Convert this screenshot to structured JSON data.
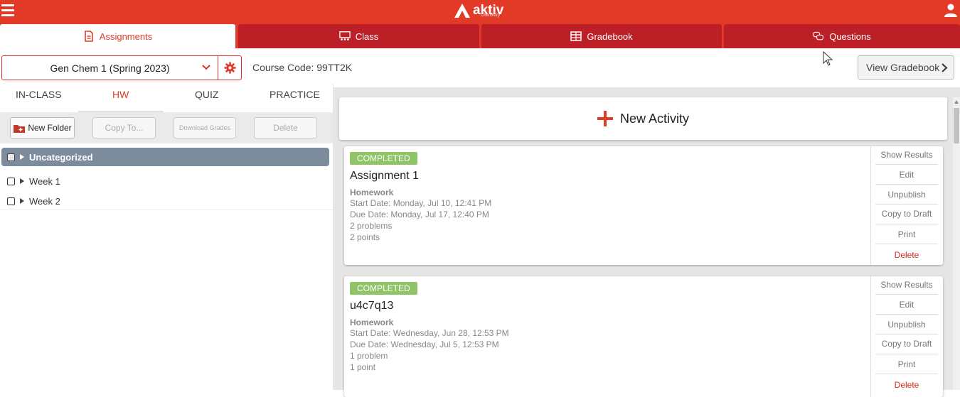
{
  "header": {
    "logo_text": "aktiv",
    "logo_sub": "Chemistry"
  },
  "tabs": [
    {
      "label": "Assignments",
      "icon": "assignment-icon",
      "active": true
    },
    {
      "label": "Class",
      "icon": "class-icon",
      "active": false
    },
    {
      "label": "Gradebook",
      "icon": "gradebook-icon",
      "active": false
    },
    {
      "label": "Questions",
      "icon": "questions-icon",
      "active": false
    }
  ],
  "course": {
    "selected": "Gen Chem 1 (Spring 2023)",
    "code_label": "Course Code: 99TT2K",
    "view_gradebook": "View Gradebook"
  },
  "subtabs": [
    {
      "label": "IN-CLASS",
      "active": false
    },
    {
      "label": "HW",
      "active": true
    },
    {
      "label": "QUIZ",
      "active": false
    },
    {
      "label": "PRACTICE",
      "active": false
    }
  ],
  "toolbar": {
    "new_folder": "New Folder",
    "copy_to": "Copy To...",
    "download_grades": "Download Grades",
    "delete": "Delete"
  },
  "folders": {
    "uncategorized": "Uncategorized",
    "weeks": [
      "Week 1",
      "Week 2"
    ]
  },
  "new_activity": "New Activity",
  "assignments": [
    {
      "status": "COMPLETED",
      "title": "Assignment 1",
      "type": "Homework",
      "start": "Start Date: Monday, Jul 10, 12:41 PM",
      "due": "Due Date: Monday, Jul 17, 12:40 PM",
      "problems": "2 problems",
      "points": "2 points"
    },
    {
      "status": "COMPLETED",
      "title": "u4c7q13",
      "type": "Homework",
      "start": "Start Date: Wednesday, Jun 28, 12:53 PM",
      "due": "Due Date: Wednesday, Jul 5, 12:53 PM",
      "problems": "1 problem",
      "points": "1 point"
    }
  ],
  "card_actions": [
    "Show Results",
    "Edit",
    "Unpublish",
    "Copy to Draft",
    "Print",
    "Delete"
  ],
  "colors": {
    "brand_red": "#e23a27",
    "tab_dark_red": "#bd1f26",
    "completed_green": "#8fc567",
    "folder_header": "#7d8c9d"
  }
}
